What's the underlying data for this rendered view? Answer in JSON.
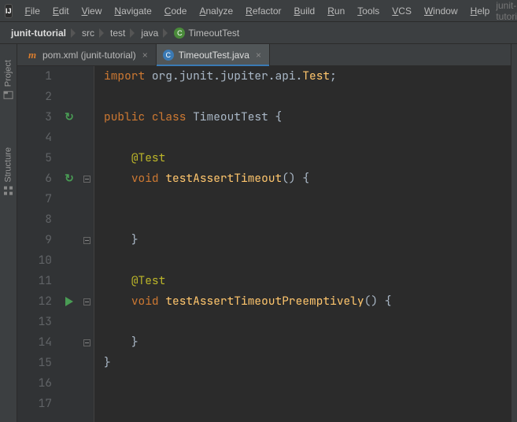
{
  "window_title": "junit-tutori",
  "menu": [
    "File",
    "Edit",
    "View",
    "Navigate",
    "Code",
    "Analyze",
    "Refactor",
    "Build",
    "Run",
    "Tools",
    "VCS",
    "Window",
    "Help"
  ],
  "breadcrumbs": {
    "root": "junit-tutorial",
    "segments": [
      "src",
      "test",
      "java"
    ],
    "class": "TimeoutTest"
  },
  "side_tabs": {
    "project": "Project",
    "structure": "Structure"
  },
  "tabs": [
    {
      "label": "pom.xml (junit-tutorial)",
      "active": false,
      "icon": "maven"
    },
    {
      "label": "TimeoutTest.java",
      "active": true,
      "icon": "java"
    }
  ],
  "editor": {
    "lines": [
      {
        "n": 1,
        "tokens": [
          [
            "kw",
            "import"
          ],
          [
            "sp",
            " "
          ],
          [
            "pk",
            "org.junit.jupiter.api."
          ],
          [
            "fn",
            "Test"
          ],
          [
            "punct",
            ";"
          ]
        ]
      },
      {
        "n": 2,
        "tokens": []
      },
      {
        "n": 3,
        "marker": "cycle",
        "tokens": [
          [
            "kw",
            "public"
          ],
          [
            "sp",
            " "
          ],
          [
            "kw",
            "class"
          ],
          [
            "sp",
            " "
          ],
          [
            "cls",
            "TimeoutTest"
          ],
          [
            "sp",
            " "
          ],
          [
            "punct",
            "{"
          ]
        ]
      },
      {
        "n": 4,
        "tokens": []
      },
      {
        "n": 5,
        "tokens": [
          [
            "sp",
            "    "
          ],
          [
            "ann",
            "@Test"
          ]
        ]
      },
      {
        "n": 6,
        "marker": "cycle",
        "fold": true,
        "tokens": [
          [
            "sp",
            "    "
          ],
          [
            "kw",
            "void"
          ],
          [
            "sp",
            " "
          ],
          [
            "fn",
            "testAssertTimeout"
          ],
          [
            "punct",
            "()"
          ],
          [
            "sp",
            " "
          ],
          [
            "punct",
            "{"
          ]
        ]
      },
      {
        "n": 7,
        "tokens": []
      },
      {
        "n": 8,
        "tokens": []
      },
      {
        "n": 9,
        "fold": true,
        "tokens": [
          [
            "sp",
            "    "
          ],
          [
            "punct",
            "}"
          ]
        ]
      },
      {
        "n": 10,
        "tokens": []
      },
      {
        "n": 11,
        "tokens": [
          [
            "sp",
            "    "
          ],
          [
            "ann",
            "@Test"
          ]
        ]
      },
      {
        "n": 12,
        "marker": "run",
        "fold": true,
        "tokens": [
          [
            "sp",
            "    "
          ],
          [
            "kw",
            "void"
          ],
          [
            "sp",
            " "
          ],
          [
            "fn",
            "testAssertTimeoutPreemptively"
          ],
          [
            "punct",
            "()"
          ],
          [
            "sp",
            " "
          ],
          [
            "punct",
            "{"
          ]
        ]
      },
      {
        "n": 13,
        "tokens": []
      },
      {
        "n": 14,
        "fold": true,
        "tokens": [
          [
            "sp",
            "    "
          ],
          [
            "punct",
            "}"
          ]
        ]
      },
      {
        "n": 15,
        "tokens": [
          [
            "punct",
            "}"
          ]
        ]
      },
      {
        "n": 16,
        "tokens": []
      },
      {
        "n": 17,
        "tokens": []
      }
    ]
  }
}
